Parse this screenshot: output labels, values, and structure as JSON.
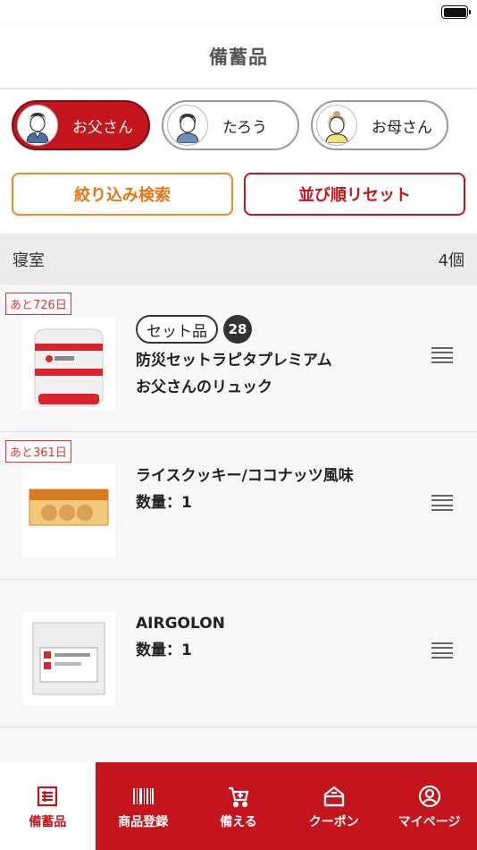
{
  "header": {
    "title": "備蓄品"
  },
  "members": [
    {
      "name": "お父さん",
      "active": true,
      "avatar_icon": "father-avatar-icon"
    },
    {
      "name": "たろう",
      "active": false,
      "avatar_icon": "boy-avatar-icon"
    },
    {
      "name": "お母さん",
      "active": false,
      "avatar_icon": "mother-avatar-icon"
    }
  ],
  "filters": {
    "filter_label": "絞り込み検索",
    "reset_label": "並び順リセット"
  },
  "section": {
    "name": "寝室",
    "count": "4個"
  },
  "items": [
    {
      "badge": "あと726日",
      "tag": "セット品",
      "tag_count": "28",
      "name": "防災セットラピタプレミアム",
      "subtitle": "お父さんのリュック"
    },
    {
      "badge": "あと361日",
      "name": "ライスクッキー/ココナッツ風味",
      "qty": "数量：1"
    },
    {
      "name": "AIRGOLON",
      "qty": "数量：1"
    }
  ],
  "tabs": [
    {
      "label": "備蓄品",
      "icon": "list-icon",
      "active": true
    },
    {
      "label": "商品登録",
      "icon": "barcode-icon",
      "active": false
    },
    {
      "label": "備える",
      "icon": "cart-icon",
      "active": false
    },
    {
      "label": "クーポン",
      "icon": "coupon-icon",
      "active": false
    },
    {
      "label": "マイページ",
      "icon": "user-icon",
      "active": false
    }
  ],
  "colors": {
    "brand_red": "#c4151c",
    "filter_orange": "#f2881e",
    "badge_red": "#e0343a"
  }
}
